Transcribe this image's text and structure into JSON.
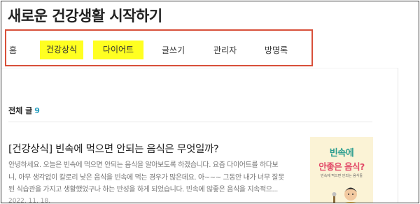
{
  "blog": {
    "title": "새로운 건강생활 시작하기"
  },
  "nav": {
    "items": [
      {
        "label": "홈"
      },
      {
        "label": "건강상식"
      },
      {
        "label": "다이어트"
      },
      {
        "label": "글쓰기"
      },
      {
        "label": "관리자"
      },
      {
        "label": "방명록"
      }
    ],
    "highlight_color": "#ffff21",
    "annotation_box_color": "#d8503a"
  },
  "list": {
    "label": "전체 글",
    "count": "9"
  },
  "post": {
    "title": "[건강상식] 빈속에 먹으면 안되는 음식은 무엇일까?",
    "excerpt": [
      "안녕하세요. 오늘은 빈속에 먹으면 안되는 음식을 알아보도록 하겠습니다. 요즘 다이어트를 하다보",
      "니, 아무 생각없이 칼로리 낮은 음식을 빈속에 먹는 경우가 많은데요. 아~~~ 그동안 내가 너무 잘못",
      "된 식습관을 가지고 생활했었구나 하는 반성을 하게 되었습니다. 빈속에 않좋은 음식을 지속적으..."
    ],
    "date": "2022. 11. 18.",
    "thumbnail": {
      "line1": "빈속에",
      "line2": "안좋은 음식?",
      "caption": "빈속에 먹으면 안되는 음식들"
    }
  }
}
